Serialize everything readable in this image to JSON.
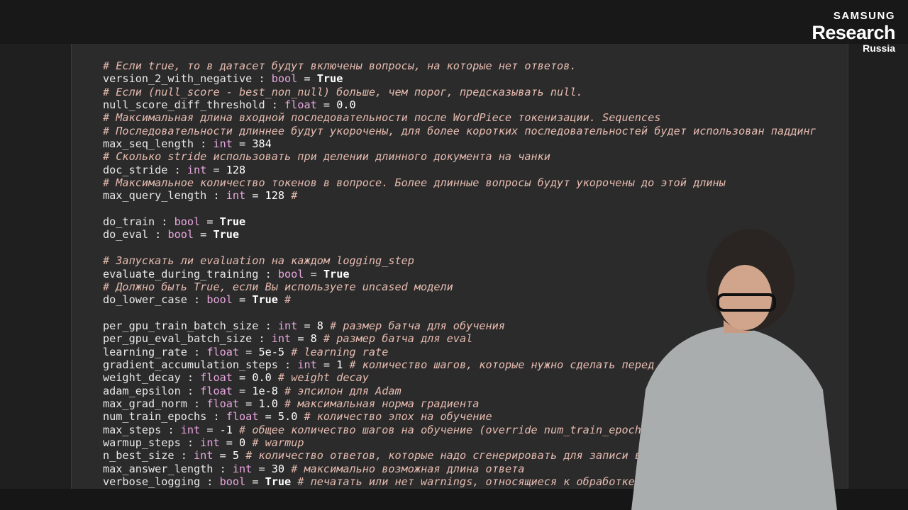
{
  "logo": {
    "line1": "SAMSUNG",
    "line2": "Research",
    "line3": "Russia"
  },
  "code_lines": [
    [
      {
        "t": "# Если true, то в датасет будут включены вопросы, на которые нет ответов.",
        "c": "c"
      }
    ],
    [
      {
        "t": "version_2_with_negative",
        "c": "v"
      },
      {
        "t": " : ",
        "c": "v"
      },
      {
        "t": "bool",
        "c": "t"
      },
      {
        "t": " = ",
        "c": "v"
      },
      {
        "t": "True",
        "c": "k"
      }
    ],
    [
      {
        "t": "# Если (null_score - best_non_null) больше, чем порог, предсказывать null.",
        "c": "c"
      }
    ],
    [
      {
        "t": "null_score_diff_threshold",
        "c": "v"
      },
      {
        "t": " : ",
        "c": "v"
      },
      {
        "t": "float",
        "c": "t"
      },
      {
        "t": " = ",
        "c": "v"
      },
      {
        "t": "0.0",
        "c": "n"
      }
    ],
    [
      {
        "t": "# Максимальная длина входной последовательности после WordPiece токенизации. Sequences",
        "c": "c"
      }
    ],
    [
      {
        "t": "# Последовательности длиннее будут укорочены, для более коротких последовательностей будет использован паддинг",
        "c": "c"
      }
    ],
    [
      {
        "t": "max_seq_length",
        "c": "v"
      },
      {
        "t": " : ",
        "c": "v"
      },
      {
        "t": "int",
        "c": "t"
      },
      {
        "t": " = ",
        "c": "v"
      },
      {
        "t": "384",
        "c": "n"
      }
    ],
    [
      {
        "t": "# Сколько stride использовать при делении длинного документа на чанки",
        "c": "c"
      }
    ],
    [
      {
        "t": "doc_stride",
        "c": "v"
      },
      {
        "t": " : ",
        "c": "v"
      },
      {
        "t": "int",
        "c": "t"
      },
      {
        "t": " = ",
        "c": "v"
      },
      {
        "t": "128",
        "c": "n"
      }
    ],
    [
      {
        "t": "# Максимальное количество токенов в вопросе. Более длинные вопросы будут укорочены до этой длины",
        "c": "c"
      }
    ],
    [
      {
        "t": "max_query_length",
        "c": "v"
      },
      {
        "t": " : ",
        "c": "v"
      },
      {
        "t": "int",
        "c": "t"
      },
      {
        "t": " = ",
        "c": "v"
      },
      {
        "t": "128",
        "c": "n"
      },
      {
        "t": " #",
        "c": "c"
      }
    ],
    [],
    [
      {
        "t": "do_train",
        "c": "v"
      },
      {
        "t": " : ",
        "c": "v"
      },
      {
        "t": "bool",
        "c": "t"
      },
      {
        "t": " = ",
        "c": "v"
      },
      {
        "t": "True",
        "c": "k"
      }
    ],
    [
      {
        "t": "do_eval",
        "c": "v"
      },
      {
        "t": " : ",
        "c": "v"
      },
      {
        "t": "bool",
        "c": "t"
      },
      {
        "t": " = ",
        "c": "v"
      },
      {
        "t": "True",
        "c": "k"
      }
    ],
    [],
    [
      {
        "t": "# Запускать ли evaluation на каждом logging_step",
        "c": "c"
      }
    ],
    [
      {
        "t": "evaluate_during_training",
        "c": "v"
      },
      {
        "t": " : ",
        "c": "v"
      },
      {
        "t": "bool",
        "c": "t"
      },
      {
        "t": " = ",
        "c": "v"
      },
      {
        "t": "True",
        "c": "k"
      }
    ],
    [
      {
        "t": "# Должно быть True, если Вы используете uncased модели",
        "c": "c"
      }
    ],
    [
      {
        "t": "do_lower_case",
        "c": "v"
      },
      {
        "t": " : ",
        "c": "v"
      },
      {
        "t": "bool",
        "c": "t"
      },
      {
        "t": " = ",
        "c": "v"
      },
      {
        "t": "True",
        "c": "k"
      },
      {
        "t": " #",
        "c": "c"
      }
    ],
    [],
    [
      {
        "t": "per_gpu_train_batch_size",
        "c": "v"
      },
      {
        "t": " : ",
        "c": "v"
      },
      {
        "t": "int",
        "c": "t"
      },
      {
        "t": " = ",
        "c": "v"
      },
      {
        "t": "8",
        "c": "n"
      },
      {
        "t": " # размер батча для обучения",
        "c": "c"
      }
    ],
    [
      {
        "t": "per_gpu_eval_batch_size",
        "c": "v"
      },
      {
        "t": " : ",
        "c": "v"
      },
      {
        "t": "int",
        "c": "t"
      },
      {
        "t": " = ",
        "c": "v"
      },
      {
        "t": "8",
        "c": "n"
      },
      {
        "t": " # размер батча для eval",
        "c": "c"
      }
    ],
    [
      {
        "t": "learning_rate",
        "c": "v"
      },
      {
        "t": " : ",
        "c": "v"
      },
      {
        "t": "float",
        "c": "t"
      },
      {
        "t": " = ",
        "c": "v"
      },
      {
        "t": "5e-5",
        "c": "n"
      },
      {
        "t": " # learning rate",
        "c": "c"
      }
    ],
    [
      {
        "t": "gradient_accumulation_steps",
        "c": "v"
      },
      {
        "t": " : ",
        "c": "v"
      },
      {
        "t": "int",
        "c": "t"
      },
      {
        "t": " = ",
        "c": "v"
      },
      {
        "t": "1",
        "c": "n"
      },
      {
        "t": " # количество шагов, которые нужно сделать перед b",
        "c": "c"
      }
    ],
    [
      {
        "t": "weight_decay",
        "c": "v"
      },
      {
        "t": " : ",
        "c": "v"
      },
      {
        "t": "float",
        "c": "t"
      },
      {
        "t": " = ",
        "c": "v"
      },
      {
        "t": "0.0",
        "c": "n"
      },
      {
        "t": " # weight decay",
        "c": "c"
      }
    ],
    [
      {
        "t": "adam_epsilon",
        "c": "v"
      },
      {
        "t": " : ",
        "c": "v"
      },
      {
        "t": "float",
        "c": "t"
      },
      {
        "t": " = ",
        "c": "v"
      },
      {
        "t": "1e-8",
        "c": "n"
      },
      {
        "t": " # эпсилон для Adam",
        "c": "c"
      }
    ],
    [
      {
        "t": "max_grad_norm",
        "c": "v"
      },
      {
        "t": " : ",
        "c": "v"
      },
      {
        "t": "float",
        "c": "t"
      },
      {
        "t": " = ",
        "c": "v"
      },
      {
        "t": "1.0",
        "c": "n"
      },
      {
        "t": " # максимальная норма градиента",
        "c": "c"
      }
    ],
    [
      {
        "t": "num_train_epochs",
        "c": "v"
      },
      {
        "t": " : ",
        "c": "v"
      },
      {
        "t": "float",
        "c": "t"
      },
      {
        "t": " = ",
        "c": "v"
      },
      {
        "t": "5.0",
        "c": "n"
      },
      {
        "t": " # количество эпох на обучение",
        "c": "c"
      }
    ],
    [
      {
        "t": "max_steps",
        "c": "v"
      },
      {
        "t": " : ",
        "c": "v"
      },
      {
        "t": "int",
        "c": "t"
      },
      {
        "t": " = ",
        "c": "v"
      },
      {
        "t": "-1",
        "c": "n"
      },
      {
        "t": " # общее количество шагов на обучение (override num_train_epochs)",
        "c": "c"
      }
    ],
    [
      {
        "t": "warmup_steps",
        "c": "v"
      },
      {
        "t": " : ",
        "c": "v"
      },
      {
        "t": "int",
        "c": "t"
      },
      {
        "t": " = ",
        "c": "v"
      },
      {
        "t": "0",
        "c": "n"
      },
      {
        "t": " # warmup",
        "c": "c"
      }
    ],
    [
      {
        "t": "n_best_size",
        "c": "v"
      },
      {
        "t": " : ",
        "c": "v"
      },
      {
        "t": "int",
        "c": "t"
      },
      {
        "t": " = ",
        "c": "v"
      },
      {
        "t": "5",
        "c": "n"
      },
      {
        "t": " # количество ответов, которые надо сгенерировать для записи в",
        "c": "c"
      }
    ],
    [
      {
        "t": "max_answer_length",
        "c": "v"
      },
      {
        "t": " : ",
        "c": "v"
      },
      {
        "t": "int",
        "c": "t"
      },
      {
        "t": " = ",
        "c": "v"
      },
      {
        "t": "30",
        "c": "n"
      },
      {
        "t": " # максимально возможная длина ответа",
        "c": "c"
      }
    ],
    [
      {
        "t": "verbose_logging",
        "c": "v"
      },
      {
        "t": " : ",
        "c": "v"
      },
      {
        "t": "bool",
        "c": "t"
      },
      {
        "t": " = ",
        "c": "v"
      },
      {
        "t": "True",
        "c": "k"
      },
      {
        "t": " # печатать или нет warnings, относящиеся к обработке",
        "c": "c"
      }
    ]
  ]
}
